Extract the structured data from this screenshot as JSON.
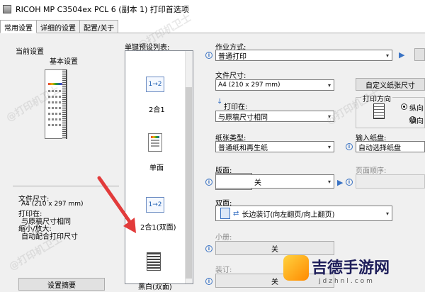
{
  "window": {
    "title": "RICOH MP C3504ex PCL 6 (副本 1) 打印首选项"
  },
  "tabs": [
    "常用设置",
    "详细的设置",
    "配置/关于"
  ],
  "current": {
    "heading": "当前设置",
    "basic": "基本设置",
    "summary": [
      "文件尺寸:",
      "A4 (210 x 297 mm)",
      "打印在:",
      "与原稿尺寸相同",
      "缩小/放大:",
      "自动配合打印尺寸"
    ],
    "summary_button": "设置摘要"
  },
  "presets": {
    "label": "单键预设列表:",
    "items": [
      "2合1",
      "单面",
      "2合1(双面)",
      "黑白(双面)"
    ],
    "icon_text": [
      "1→2",
      "1→2"
    ]
  },
  "job": {
    "label": "作业方式:",
    "value": "普通打印"
  },
  "doc_size": {
    "label": "文件尺寸:",
    "value": "A4 (210 x 297 mm)",
    "custom_button": "自定义纸张尺寸"
  },
  "print_on": {
    "label": "打印在:",
    "value": "与原稿尺寸相同"
  },
  "orientation": {
    "label": "打印方向",
    "options": [
      "纵向",
      "横向"
    ],
    "selected": 0
  },
  "paper_type": {
    "label": "纸张类型:",
    "value": "普通纸和再生纸"
  },
  "input_tray": {
    "label": "输入纸盘:",
    "value": "自动选择纸盘"
  },
  "layout": {
    "label": "版面:",
    "value": "关"
  },
  "page_order": {
    "label": "页面顺序:"
  },
  "duplex": {
    "label": "双面:",
    "value": "长边装订(向左翻页/向上翻页)"
  },
  "booklet": {
    "label": "小册:",
    "value": "关"
  },
  "staple": {
    "label": "装订:",
    "value": "关"
  },
  "watermarks": [
    "@打印机卫士",
    "@打印机卫士",
    "@打印机卫士",
    "@打印机卫士"
  ],
  "logo": {
    "text": "吉德手游网",
    "url": "jdzhnl.com"
  },
  "colors": {
    "accent": "#1e5fb4",
    "arrow": "#e23b3b"
  }
}
